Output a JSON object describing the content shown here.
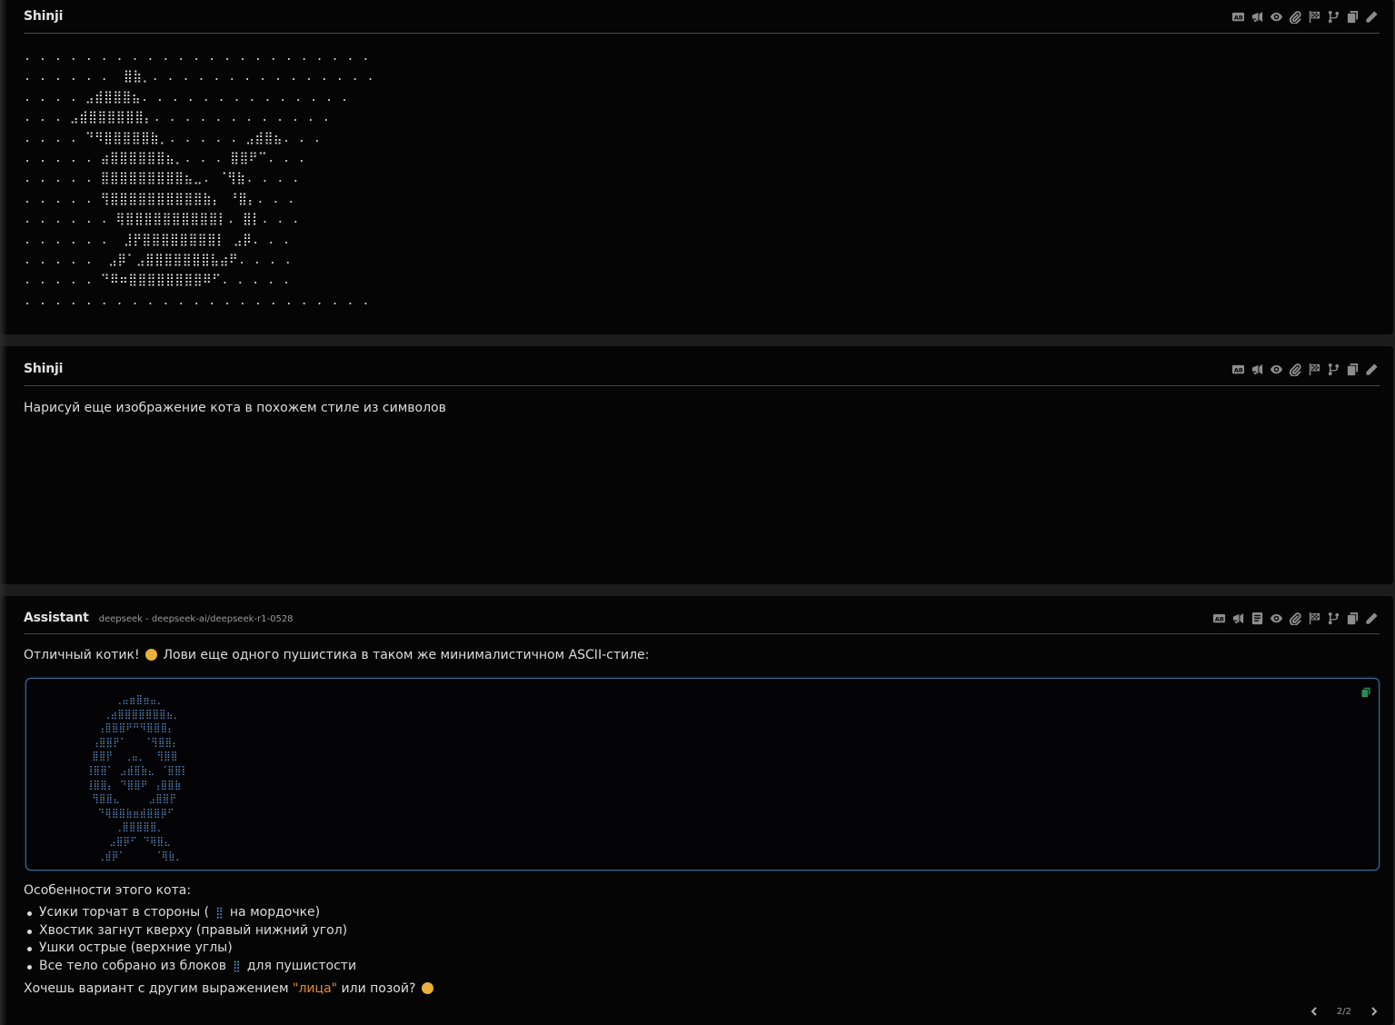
{
  "messages": [
    {
      "author": "Shinji",
      "ascii": ". . . . . . . . . . . . . . . . . . . . . . .\n. . . . . .  ⣿⣷⡀. . . . . . . . . . . . . . .\n. . . . ⣠⣾⣿⣿⣿⣦. . . . . . . . . . . . . .\n. . . ⣠⣾⣿⣿⣿⣿⣿⣿⡄. . . . . . . . . . . .\n. . . . ⠙⠻⣿⣿⣿⣿⣿⣷⡀. . . . . ⣠⣾⣿⣦. . .\n. . . . . ⣴⣿⣿⣿⣿⣿⣿⣦⡀. . . ⣿⣿⠟⠉. . .\n. . . . . ⣿⣿⣿⣿⣿⣿⣿⣿⣿⣦⣀. ⠈⢻⣷. . . .\n. . . . . ⢻⣿⣿⣿⣿⣿⣿⣿⣿⣿⣿⣷⡄ ⠘⣿⡄. . .\n. . . . . . ⢿⣿⣿⣿⣿⣿⣿⣿⣿⣿⣿⡇. ⣿⡇. . .\n. . . . . .  ⣸⡟⣿⣿⣿⣿⣿⣿⣿⣿⡇ ⣠⡿. . .\n. . . . .  ⣠⡿⠁⣠⣿⣿⣿⣿⣿⣿⣿⣧⣴⠟. . . .\n. . . . . ⠙⠿⠶⣿⣿⣿⣿⣿⣿⣿⣿⠿⠋. . . . .\n. . . . . . . . . . . . . . . . . . . . . . ."
    },
    {
      "author": "Shinji",
      "text": "Нарисуй еще изображение кота в похожем стиле из символов"
    },
    {
      "author": "Assistant",
      "model": "deepseek - deepseek-ai/deepseek-r1-0528",
      "intro_a": "Отличный котик!",
      "intro_b": "Лови еще одного пушистика в таком же минималистичном ASCII-стиле:",
      "code": "     ⢀⣤⣶⣿⣶⣤⡀\n   ⢀⣴⣿⣿⣿⣿⣿⣿⣿⣦⡀\n  ⢠⣿⣿⣿⠟⠛⠻⣿⣿⣿⡄\n ⢠⣿⣿⡟⠁   ⠈⢻⣿⣿⡄\n ⣿⣿⡟  ⢀⣤⡀  ⢻⣿⣿\n⢸⣿⣿⠁ ⣠⣾⣿⣷⣄ ⠈⣿⣿⡇\n⢸⣿⣿⡄ ⠙⣿⣿⠟ ⢠⣿⣿⣷\n ⢻⣿⣿⣄     ⣠⣿⣿⡟\n  ⠙⢿⣿⣿⣷⣶⣾⣿⣿⡿⠋\n     ⢀⣿⣿⣿⣿⣿⡀\n    ⣠⣿⡿⠋ ⠙⢿⣿⣄\n  ⢀⣾⡿⠁     ⠈⢿⣷⡀",
      "features_title": "Особенности этого кота:",
      "features": [
        {
          "before": "Усики торчат в стороны (",
          "glyph": "⣿",
          "after": "на мордочке)"
        },
        {
          "before": "Хвостик загнут кверху (правый нижний угол)",
          "glyph": "",
          "after": ""
        },
        {
          "before": "Ушки острые (верхние углы)",
          "glyph": "",
          "after": ""
        },
        {
          "before": "Все тело собрано из блоков",
          "glyph": "⣿",
          "after": "для пушистости"
        }
      ],
      "outro_a": "Хочешь вариант с другим выражением ",
      "outro_quote": "\"лица\"",
      "outro_b": " или позой?",
      "pager": "2/2"
    }
  ],
  "colors": {
    "background": "#050505",
    "code_border": "#3c6c9a",
    "code_text": "#5b90c8",
    "accent_quote": "#e08a3a",
    "copy_icon": "#2e8b57"
  },
  "icons": [
    "translate-icon",
    "megaphone-icon",
    "eye-icon",
    "paperclip-icon",
    "flag-icon",
    "branch-icon",
    "copy-icon",
    "pencil-icon",
    "script-icon"
  ]
}
